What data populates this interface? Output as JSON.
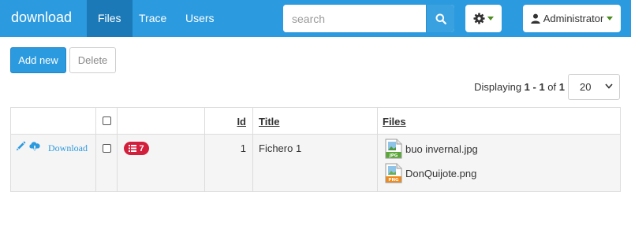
{
  "app": {
    "brand": "download"
  },
  "nav": {
    "items": [
      {
        "label": "Files",
        "active": true
      },
      {
        "label": "Trace",
        "active": false
      },
      {
        "label": "Users",
        "active": false
      }
    ]
  },
  "search": {
    "placeholder": "search",
    "value": ""
  },
  "user": {
    "name": "Administrator"
  },
  "toolbar": {
    "add_label": "Add new",
    "delete_label": "Delete"
  },
  "pagination": {
    "prefix": "Displaying ",
    "range": "1 - 1",
    "of_text": " of ",
    "total": "1",
    "page_size": "20"
  },
  "table": {
    "columns": {
      "id": "Id",
      "title": "Title",
      "files": "Files"
    },
    "rows": [
      {
        "download_label": "Download",
        "badge_count": "7",
        "id": "1",
        "title": "Fichero 1",
        "files": [
          {
            "name": "buo invernal.jpg",
            "type": "JPG"
          },
          {
            "name": "DonQuijote.png",
            "type": "PNG"
          }
        ]
      }
    ]
  },
  "colors": {
    "primary": "#2c9ade",
    "active_nav": "#1b79b8",
    "badge": "#d21f3c",
    "caret": "#4a8c1e"
  },
  "icons": [
    "search-icon",
    "gear-icon",
    "user-icon",
    "pencil-icon",
    "cloud-download-icon",
    "list-icon",
    "jpg-file-icon",
    "png-file-icon",
    "chevron-down-icon"
  ]
}
